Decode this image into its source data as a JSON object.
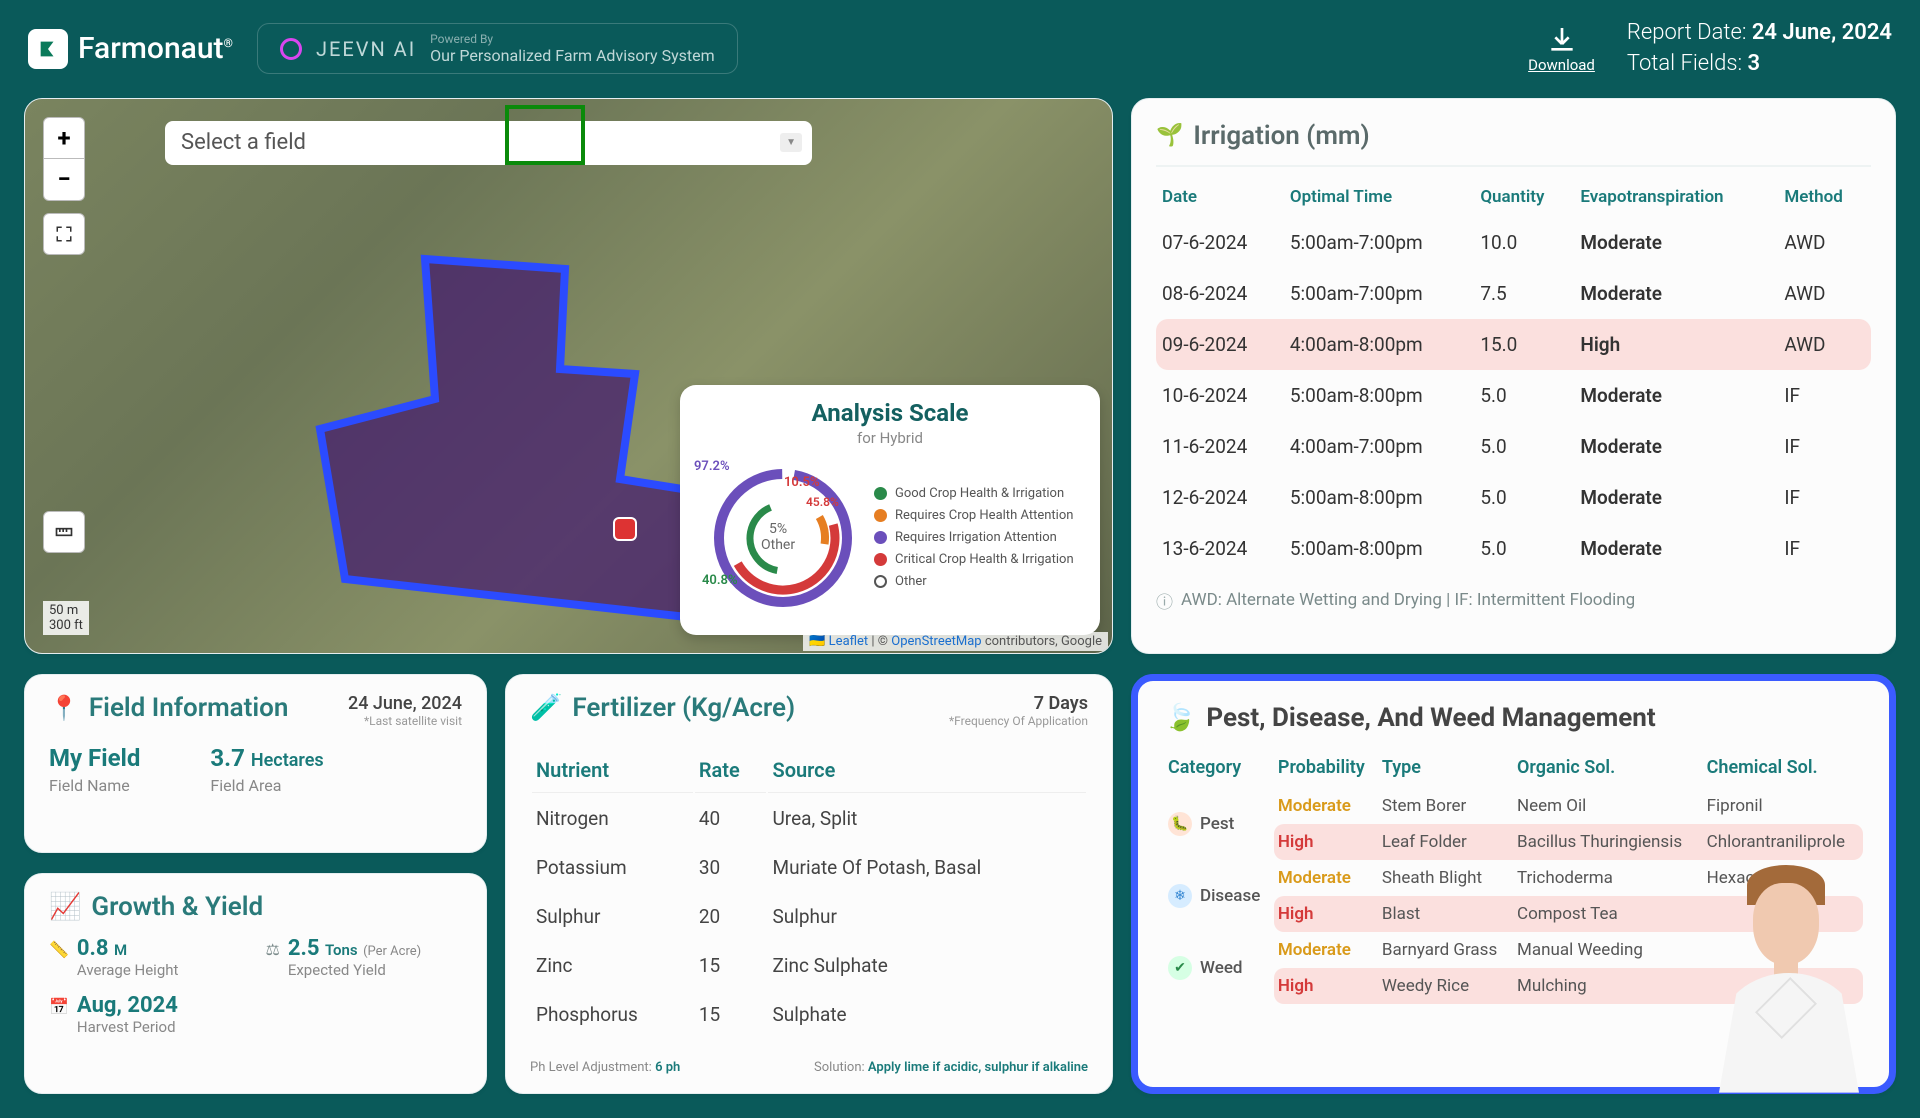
{
  "header": {
    "brand": "Farmonaut",
    "brand_suffix": "®",
    "jeevn_label": "JEEVN AI",
    "powered_by": "Powered By",
    "jeevn_sub": "Our Personalized Farm Advisory System",
    "download": "Download",
    "report_date_label": "Report Date: ",
    "report_date_value": "24 June, 2024",
    "total_fields_label": "Total Fields: ",
    "total_fields_value": "3"
  },
  "map": {
    "select_placeholder": "Select a field",
    "scale_m": "50 m",
    "scale_ft": "300 ft",
    "attrib_leaflet": "Leaflet",
    "attrib_osm": "OpenStreetMap",
    "attrib_tail": " contributors, Google",
    "analysis": {
      "title": "Analysis Scale",
      "sub": "for Hybrid",
      "center_pct": "5%",
      "center_lbl": "Other",
      "labels": {
        "purple": "97.2%",
        "orange": "10.5%",
        "red": "45.8%",
        "green": "40.8%"
      },
      "legend": [
        {
          "color": "green",
          "text": "Good Crop Health & Irrigation"
        },
        {
          "color": "orange",
          "text": "Requires Crop Health Attention"
        },
        {
          "color": "purple",
          "text": "Requires Irrigation Attention"
        },
        {
          "color": "red",
          "text": "Critical Crop Health & Irrigation"
        },
        {
          "color": "grey-ring",
          "text": "Other"
        }
      ]
    }
  },
  "irrigation": {
    "title": "Irrigation (mm)",
    "columns": {
      "date": "Date",
      "time": "Optimal Time",
      "qty": "Quantity",
      "evap": "Evapotranspiration",
      "method": "Method"
    },
    "rows": [
      {
        "date": "07-6-2024",
        "time": "5:00am-7:00pm",
        "qty": "10.0",
        "evap": "Moderate",
        "evap_cls": "mod",
        "method": "AWD",
        "hi": false
      },
      {
        "date": "08-6-2024",
        "time": "5:00am-7:00pm",
        "qty": "7.5",
        "evap": "Moderate",
        "evap_cls": "mod",
        "method": "AWD",
        "hi": false
      },
      {
        "date": "09-6-2024",
        "time": "4:00am-8:00pm",
        "qty": "15.0",
        "evap": "High",
        "evap_cls": "high",
        "method": "AWD",
        "hi": true
      },
      {
        "date": "10-6-2024",
        "time": "5:00am-8:00pm",
        "qty": "5.0",
        "evap": "Moderate",
        "evap_cls": "mod",
        "method": "IF",
        "hi": false
      },
      {
        "date": "11-6-2024",
        "time": "4:00am-7:00pm",
        "qty": "5.0",
        "evap": "Moderate",
        "evap_cls": "mod",
        "method": "IF",
        "hi": false
      },
      {
        "date": "12-6-2024",
        "time": "5:00am-8:00pm",
        "qty": "5.0",
        "evap": "Moderate",
        "evap_cls": "mod",
        "method": "IF",
        "hi": false
      },
      {
        "date": "13-6-2024",
        "time": "5:00am-8:00pm",
        "qty": "5.0",
        "evap": "Moderate",
        "evap_cls": "mod",
        "method": "IF",
        "hi": false
      }
    ],
    "footnote": "AWD: Alternate Wetting and Drying | IF: Intermittent Flooding"
  },
  "field_info": {
    "title": "Field Information",
    "date": "24 June, 2024",
    "date_note": "*Last satellite visit",
    "name_val": "My Field",
    "name_lbl": "Field Name",
    "area_val": "3.7",
    "area_unit": "Hectares",
    "area_lbl": "Field Area"
  },
  "growth": {
    "title": "Growth & Yield",
    "height_val": "0.8",
    "height_unit": "M",
    "height_lbl": "Average Height",
    "yield_val": "2.5",
    "yield_unit": "Tons",
    "yield_sup": "(Per Acre)",
    "yield_lbl": "Expected Yield",
    "harvest_val": "Aug, 2024",
    "harvest_lbl": "Harvest Period"
  },
  "fertilizer": {
    "title": "Fertilizer (Kg/Acre)",
    "freq_val": "7 Days",
    "freq_lbl": "*Frequency Of Application",
    "columns": {
      "n": "Nutrient",
      "r": "Rate",
      "s": "Source"
    },
    "rows": [
      {
        "n": "Nitrogen",
        "r": "40",
        "s": "Urea, Split"
      },
      {
        "n": "Potassium",
        "r": "30",
        "s": "Muriate Of Potash, Basal"
      },
      {
        "n": "Sulphur",
        "r": "20",
        "s": "Sulphur"
      },
      {
        "n": "Zinc",
        "r": "15",
        "s": "Zinc Sulphate"
      },
      {
        "n": "Phosphorus",
        "r": "15",
        "s": "Sulphate"
      }
    ],
    "ph_label": "Ph Level Adjustment:",
    "ph_val": "6 ph",
    "sol_label": "Solution:",
    "sol_val": "Apply lime if acidic, sulphur if alkaline"
  },
  "pest": {
    "title": "Pest, Disease, And Weed Management",
    "columns": {
      "cat": "Category",
      "prob": "Probability",
      "type": "Type",
      "org": "Organic Sol.",
      "chem": "Chemical Sol."
    },
    "categories": [
      {
        "icon": "pest-i",
        "glyph": "🐛",
        "name": "Pest",
        "rows": [
          {
            "prob": "Moderate",
            "prob_cls": "mod",
            "type": "Stem Borer",
            "org": "Neem Oil",
            "chem": "Fipronil",
            "hi": false
          },
          {
            "prob": "High",
            "prob_cls": "high",
            "type": "Leaf Folder",
            "org": "Bacillus Thuringiensis",
            "chem": "Chlorantraniliprole",
            "hi": true
          }
        ]
      },
      {
        "icon": "dis-i",
        "glyph": "❄",
        "name": "Disease",
        "rows": [
          {
            "prob": "Moderate",
            "prob_cls": "mod",
            "type": "Sheath Blight",
            "org": "Trichoderma",
            "chem": "Hexaconazole",
            "hi": false
          },
          {
            "prob": "High",
            "prob_cls": "high",
            "type": "Blast",
            "org": "Compost Tea",
            "chem": "",
            "hi": true
          }
        ]
      },
      {
        "icon": "weed-i",
        "glyph": "✔",
        "name": "Weed",
        "rows": [
          {
            "prob": "Moderate",
            "prob_cls": "mod",
            "type": "Barnyard Grass",
            "org": "Manual Weeding",
            "chem": "",
            "hi": false
          },
          {
            "prob": "High",
            "prob_cls": "high",
            "type": "Weedy Rice",
            "org": "Mulching",
            "chem": "",
            "hi": true
          }
        ]
      }
    ]
  }
}
